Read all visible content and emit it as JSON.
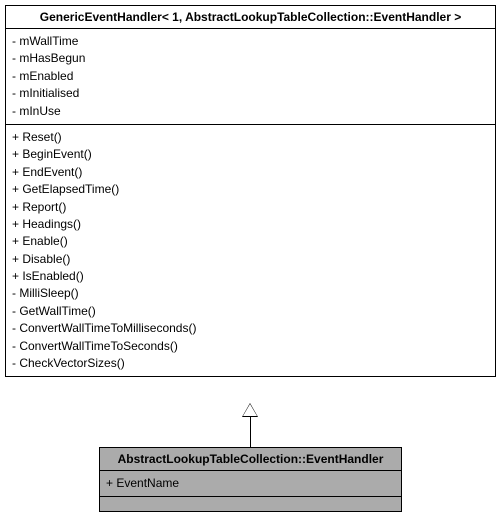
{
  "base": {
    "title": "GenericEventHandler< 1, AbstractLookupTableCollection::EventHandler >",
    "attributes": [
      "- mWallTime",
      "- mHasBegun",
      "- mEnabled",
      "- mInitialised",
      "- mInUse"
    ],
    "operations": [
      "+ Reset()",
      "+ BeginEvent()",
      "+ EndEvent()",
      "+ GetElapsedTime()",
      "+ Report()",
      "+ Headings()",
      "+ Enable()",
      "+ Disable()",
      "+ IsEnabled()",
      "- MilliSleep()",
      "- GetWallTime()",
      "- ConvertWallTimeToMilliseconds()",
      "- ConvertWallTimeToSeconds()",
      "- CheckVectorSizes()"
    ]
  },
  "derived": {
    "title": "AbstractLookupTableCollection::EventHandler",
    "attributes": [
      "+ EventName"
    ]
  }
}
